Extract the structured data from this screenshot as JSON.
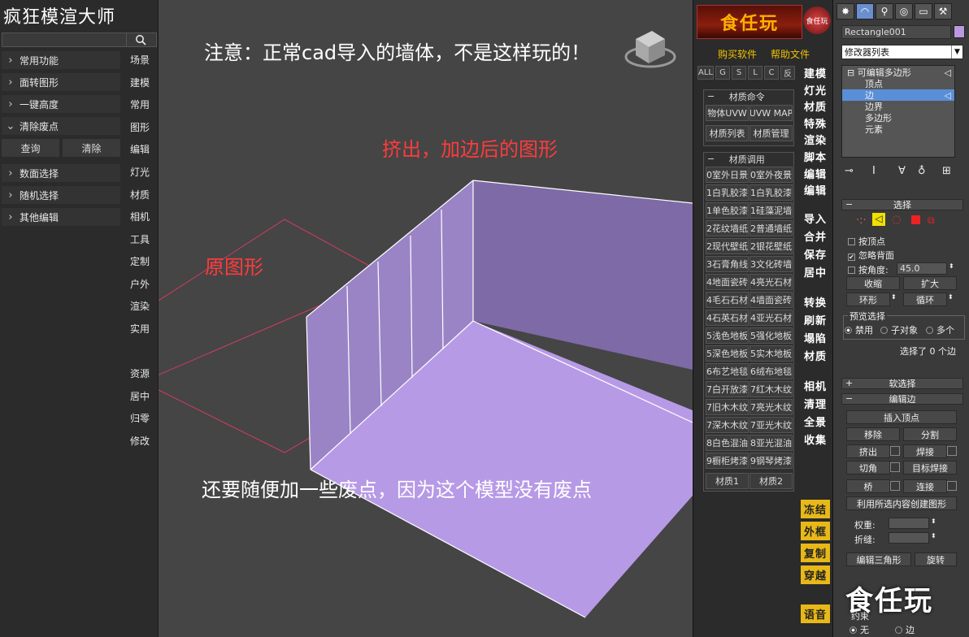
{
  "left_panel": {
    "title": "疯狂模渲大师",
    "search": {
      "value": "",
      "placeholder": ""
    },
    "menu": [
      {
        "label": "常用功能",
        "expanded": false
      },
      {
        "label": "面转图形",
        "expanded": false
      },
      {
        "label": "一键高度",
        "expanded": false
      },
      {
        "label": "清除废点",
        "expanded": true
      },
      {
        "label": "数面选择",
        "expanded": false
      },
      {
        "label": "随机选择",
        "expanded": false
      },
      {
        "label": "其他编辑",
        "expanded": false
      }
    ],
    "sub_buttons": [
      "查询",
      "清除"
    ],
    "side_labels_top": [
      "场景",
      "建模",
      "常用",
      "图形",
      "编辑",
      "灯光",
      "材质",
      "相机",
      "工具",
      "定制",
      "户外",
      "渲染",
      "实用"
    ],
    "side_labels_bottom": [
      "资源",
      "居中",
      "归零",
      "修改"
    ]
  },
  "viewport": {
    "note_top": "注意：正常cad导入的墙体，不是这样玩的！",
    "note_extruded": "挤出，加边后的图形",
    "note_original": "原图形",
    "note_bottom": "还要随便加一些废点，因为这个模型没有废点",
    "colors": {
      "note_white": "#ffffff",
      "note_red": "#ff3b3b",
      "wall_left": "#9a84c6",
      "wall_back": "#7e6aa6",
      "floor": "#b79ae6",
      "outline": "#d23c60"
    }
  },
  "center_panel": {
    "logo": "食任玩",
    "logo_round": "食任玩",
    "links": [
      "购买软件",
      "帮助文件"
    ],
    "filters": [
      "ALL",
      "G",
      "S",
      "L",
      "C",
      "反"
    ],
    "group_material_cmd": {
      "title": "材质命令",
      "buttons": [
        "物体UVW",
        "UVW MAP",
        "材质列表",
        "材质管理"
      ]
    },
    "group_material_call": {
      "title": "材质调用",
      "buttons": [
        [
          "0室外日景",
          "0室外夜景"
        ],
        [
          "1白乳胶漆",
          "1白乳胶漆"
        ],
        [
          "1单色胶漆",
          "1硅藻泥墙"
        ],
        [
          "2花纹墙纸",
          "2普通墙纸"
        ],
        [
          "2现代壁纸",
          "2银花壁纸"
        ],
        [
          "3石膏角线",
          "3文化砖墙"
        ],
        [
          "4地面瓷砖",
          "4亮光石材"
        ],
        [
          "4毛石石材",
          "4墙面瓷砖"
        ],
        [
          "4石英石材",
          "4亚光石材"
        ],
        [
          "5浅色地板",
          "5强化地板"
        ],
        [
          "5深色地板",
          "5实木地板"
        ],
        [
          "6布艺地毯",
          "6绒布地毯"
        ],
        [
          "7白开放漆",
          "7红木木纹"
        ],
        [
          "7旧木木纹",
          "7亮光木纹"
        ],
        [
          "7深木木纹",
          "7亚光木纹"
        ],
        [
          "8白色混油",
          "8亚光混油"
        ],
        [
          "9橱柜烤漆",
          "9钢琴烤漆"
        ]
      ],
      "footer": [
        "材质1",
        "材质2"
      ]
    },
    "tools_group1": [
      "建模",
      "灯光",
      "材质",
      "特殊",
      "渲染",
      "脚本",
      "编辑",
      "编辑"
    ],
    "tools_group2": [
      "导入",
      "合并",
      "保存",
      "居中"
    ],
    "tools_group3": [
      "转换",
      "刷新",
      "塌陷",
      "材质"
    ],
    "tools_group4": [
      "相机",
      "清理",
      "全景",
      "收集"
    ],
    "tools_yellow": [
      "冻结",
      "外框",
      "复制",
      "穿越"
    ],
    "tool_last": "语音"
  },
  "command_panel": {
    "object_name": "Rectangle001",
    "modifier_list": "修改器列表",
    "stack": {
      "root": "可编辑多边形",
      "items": [
        "顶点",
        "边",
        "边界",
        "多边形",
        "元素"
      ],
      "selected": "边"
    },
    "selection_rollout": {
      "title": "选择",
      "by_vertex": "按顶点",
      "ignore_backface": "忽略背面",
      "by_angle": "按角度:",
      "angle_value": "45.0",
      "shrink": "收缩",
      "grow": "扩大",
      "ring": "环形",
      "loop": "循环",
      "preview_title": "预览选择",
      "preview_options": [
        "禁用",
        "子对象",
        "多个"
      ],
      "status": "选择了 0 个边"
    },
    "soft_selection": "软选择",
    "edit_edges": {
      "title": "编辑边",
      "insert_vertex": "插入顶点",
      "remove": "移除",
      "split": "分割",
      "extrude": "挤出",
      "weld": "焊接",
      "chamfer": "切角",
      "target_weld": "目标焊接",
      "bridge": "桥",
      "connect": "连接",
      "create_shape": "利用所选内容创建图形",
      "weight": "权重:",
      "crease": "折缝:",
      "edit_tri": "编辑三角形",
      "rotate": "旋转"
    },
    "constraint_title": "约束",
    "constraint_options": [
      "无",
      "边"
    ],
    "accent_color": "#5a8fd8",
    "swatch_color": "#b99ae0"
  },
  "watermark": "食任玩"
}
